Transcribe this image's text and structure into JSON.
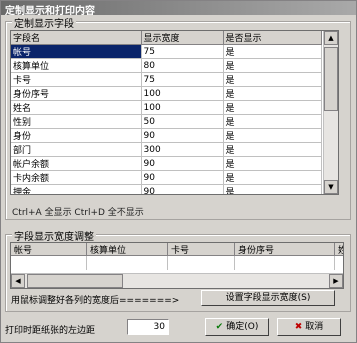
{
  "window": {
    "title": "定制显示和打印内容"
  },
  "fields_group": {
    "title": "定制显示字段",
    "columns": [
      "字段名",
      "显示宽度",
      "是否显示"
    ],
    "rows": [
      {
        "name": "帐号",
        "width": "75",
        "visible": "是"
      },
      {
        "name": "核算单位",
        "width": "80",
        "visible": "是"
      },
      {
        "name": "卡号",
        "width": "75",
        "visible": "是"
      },
      {
        "name": "身份序号",
        "width": "100",
        "visible": "是"
      },
      {
        "name": "姓名",
        "width": "100",
        "visible": "是"
      },
      {
        "name": "性别",
        "width": "50",
        "visible": "是"
      },
      {
        "name": "身份",
        "width": "90",
        "visible": "是"
      },
      {
        "name": "部门",
        "width": "300",
        "visible": "是"
      },
      {
        "name": "帐户余额",
        "width": "90",
        "visible": "是"
      },
      {
        "name": "卡内余额",
        "width": "90",
        "visible": "是"
      },
      {
        "name": "押金",
        "width": "90",
        "visible": "是"
      }
    ],
    "hint": "Ctrl+A 全显示 Ctrl+D 全不显示"
  },
  "width_group": {
    "title": "字段显示宽度调整",
    "columns": [
      "帐号",
      "核算单位",
      "卡号",
      "身份序号",
      "姓"
    ],
    "instruction": "用鼠标调整好各列的宽度后=======>",
    "apply_button": "设置字段显示宽度(S)"
  },
  "footer": {
    "margin_label": "打印时距纸张的左边距",
    "margin_value": "30",
    "ok_button": "确定(O)",
    "cancel_button": "取消"
  }
}
